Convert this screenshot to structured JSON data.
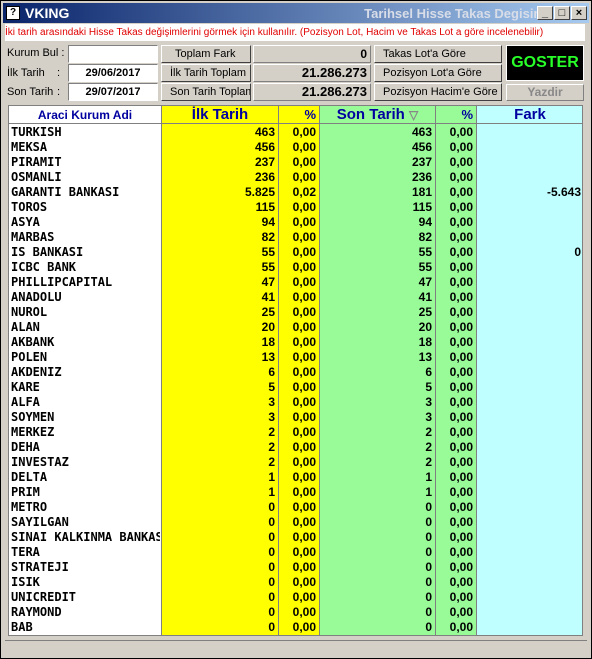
{
  "window": {
    "app_title": "VKING",
    "title_right": "Tarihsel Hisse Takas Degisim",
    "app_icon_glyph": "?",
    "minimize_glyph": "_",
    "maximize_glyph": "□",
    "close_glyph": "×"
  },
  "notice": "İki tarih arasındaki Hisse Takas değişimlerini görmek için kullanılır. (Pozisyon Lot, Hacim ve Takas Lot a göre incelenebilir)",
  "filters": {
    "kurum_bul_label": "Kurum Bul :",
    "kurum_bul_value": "",
    "ilk_tarih_label": "İlk Tarih",
    "ilk_tarih_value": "29/06/2017",
    "son_tarih_label": "Son Tarih",
    "son_tarih_value": "29/07/2017",
    "colon": ":"
  },
  "summary": {
    "toplam_fark_label": "Toplam Fark",
    "toplam_fark_value": "0",
    "ilk_tarih_toplam_label": "İlk Tarih Toplam",
    "ilk_tarih_toplam_value": "21.286.273",
    "son_tarih_toplam_label": "Son Tarih Toplam",
    "son_tarih_toplam_value": "21.286.273"
  },
  "modes": {
    "takas_lot": "Takas Lot'a Göre",
    "pozisyon_lot": "Pozisyon Lot'a Göre",
    "pozisyon_hacim": "Pozisyon Hacim'e Göre"
  },
  "actions": {
    "goster": "GOSTER",
    "yazdir": "Yazdir"
  },
  "table": {
    "headers": {
      "name": "Araci Kurum Adi",
      "ilk": "İlk Tarih",
      "pct1": "%",
      "son": "Son Tarih",
      "sort_glyph": "▽",
      "pct2": "%",
      "fark": "Fark"
    },
    "column_colors": {
      "ilk": "#ffff00",
      "son": "#98fb98",
      "fark": "#c0ffff"
    },
    "rows": [
      [
        "TURKISH",
        "463",
        "0,00",
        "463",
        "0,00",
        ""
      ],
      [
        "MEKSA",
        "456",
        "0,00",
        "456",
        "0,00",
        ""
      ],
      [
        "PIRAMIT",
        "237",
        "0,00",
        "237",
        "0,00",
        ""
      ],
      [
        "OSMANLI",
        "236",
        "0,00",
        "236",
        "0,00",
        ""
      ],
      [
        "GARANTI BANKASI",
        "5.825",
        "0,02",
        "181",
        "0,00",
        "-5.643"
      ],
      [
        "TOROS",
        "115",
        "0,00",
        "115",
        "0,00",
        ""
      ],
      [
        "ASYA",
        "94",
        "0,00",
        "94",
        "0,00",
        ""
      ],
      [
        "MARBAS",
        "82",
        "0,00",
        "82",
        "0,00",
        ""
      ],
      [
        "IS BANKASI",
        "55",
        "0,00",
        "55",
        "0,00",
        "0"
      ],
      [
        "ICBC BANK",
        "55",
        "0,00",
        "55",
        "0,00",
        ""
      ],
      [
        "PHILLIPCAPITAL",
        "47",
        "0,00",
        "47",
        "0,00",
        ""
      ],
      [
        "ANADOLU",
        "41",
        "0,00",
        "41",
        "0,00",
        ""
      ],
      [
        "NUROL",
        "25",
        "0,00",
        "25",
        "0,00",
        ""
      ],
      [
        "ALAN",
        "20",
        "0,00",
        "20",
        "0,00",
        ""
      ],
      [
        "AKBANK",
        "18",
        "0,00",
        "18",
        "0,00",
        ""
      ],
      [
        "POLEN",
        "13",
        "0,00",
        "13",
        "0,00",
        ""
      ],
      [
        "AKDENIZ",
        "6",
        "0,00",
        "6",
        "0,00",
        ""
      ],
      [
        "KARE",
        "5",
        "0,00",
        "5",
        "0,00",
        ""
      ],
      [
        "ALFA",
        "3",
        "0,00",
        "3",
        "0,00",
        ""
      ],
      [
        "SOYMEN",
        "3",
        "0,00",
        "3",
        "0,00",
        ""
      ],
      [
        "MERKEZ",
        "2",
        "0,00",
        "2",
        "0,00",
        ""
      ],
      [
        "DEHA",
        "2",
        "0,00",
        "2",
        "0,00",
        ""
      ],
      [
        "INVESTAZ",
        "2",
        "0,00",
        "2",
        "0,00",
        ""
      ],
      [
        "DELTA",
        "1",
        "0,00",
        "1",
        "0,00",
        ""
      ],
      [
        "PRIM",
        "1",
        "0,00",
        "1",
        "0,00",
        ""
      ],
      [
        "METRO",
        "0",
        "0,00",
        "0",
        "0,00",
        ""
      ],
      [
        "SAYILGAN",
        "0",
        "0,00",
        "0",
        "0,00",
        ""
      ],
      [
        "SINAI KALKINMA BANKASI",
        "0",
        "0,00",
        "0",
        "0,00",
        ""
      ],
      [
        "TERA",
        "0",
        "0,00",
        "0",
        "0,00",
        ""
      ],
      [
        "STRATEJI",
        "0",
        "0,00",
        "0",
        "0,00",
        ""
      ],
      [
        "ISIK",
        "0",
        "0,00",
        "0",
        "0,00",
        ""
      ],
      [
        "UNICREDIT",
        "0",
        "0,00",
        "0",
        "0,00",
        ""
      ],
      [
        "RAYMOND",
        "0",
        "0,00",
        "0",
        "0,00",
        ""
      ],
      [
        "BAB",
        "0",
        "0,00",
        "0",
        "0,00",
        ""
      ]
    ]
  }
}
